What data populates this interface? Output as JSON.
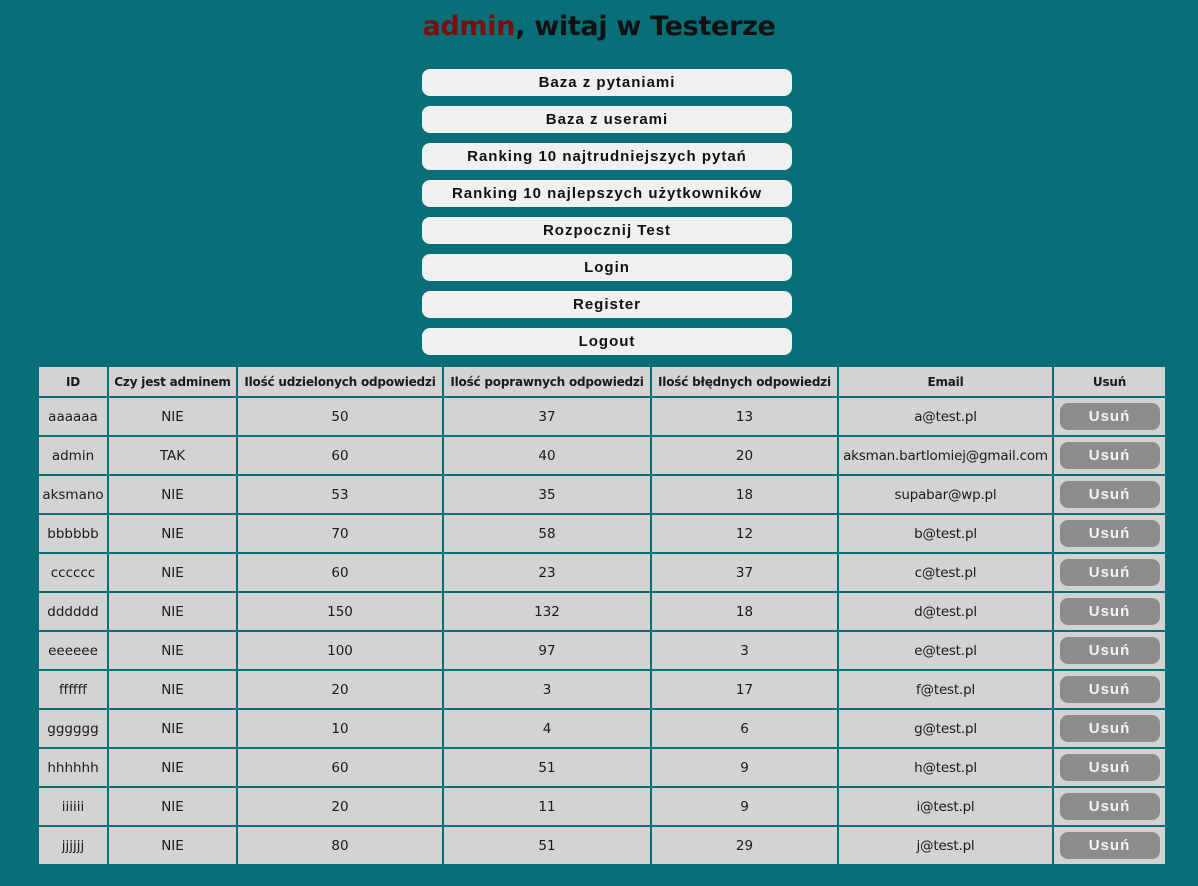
{
  "header": {
    "username": "admin",
    "greeting": ", witaj w Testerze"
  },
  "menu": [
    {
      "label": "Baza z pytaniami",
      "name": "questions-db-button"
    },
    {
      "label": "Baza z userami",
      "name": "users-db-button"
    },
    {
      "label": "Ranking 10 najtrudniejszych pytań",
      "name": "hardest-questions-ranking-button"
    },
    {
      "label": "Ranking 10 najlepszych użytkowników",
      "name": "best-users-ranking-button"
    },
    {
      "label": "Rozpocznij Test",
      "name": "start-test-button"
    },
    {
      "label": "Login",
      "name": "login-button"
    },
    {
      "label": "Register",
      "name": "register-button"
    },
    {
      "label": "Logout",
      "name": "logout-button"
    }
  ],
  "table": {
    "columns": [
      "ID",
      "Czy jest adminem",
      "Ilość udzielonych odpowiedzi",
      "Ilość poprawnych odpowiedzi",
      "Ilość błędnych odpowiedzi",
      "Email",
      "Usuń"
    ],
    "delete_label": "Usuń",
    "rows": [
      [
        "aaaaaa",
        "NIE",
        "50",
        "37",
        "13",
        "a@test.pl"
      ],
      [
        "admin",
        "TAK",
        "60",
        "40",
        "20",
        "aksman.bartlomiej@gmail.com"
      ],
      [
        "aksmano",
        "NIE",
        "53",
        "35",
        "18",
        "supabar@wp.pl"
      ],
      [
        "bbbbbb",
        "NIE",
        "70",
        "58",
        "12",
        "b@test.pl"
      ],
      [
        "cccccc",
        "NIE",
        "60",
        "23",
        "37",
        "c@test.pl"
      ],
      [
        "dddddd",
        "NIE",
        "150",
        "132",
        "18",
        "d@test.pl"
      ],
      [
        "eeeeee",
        "NIE",
        "100",
        "97",
        "3",
        "e@test.pl"
      ],
      [
        "ffffff",
        "NIE",
        "20",
        "3",
        "17",
        "f@test.pl"
      ],
      [
        "gggggg",
        "NIE",
        "10",
        "4",
        "6",
        "g@test.pl"
      ],
      [
        "hhhhhh",
        "NIE",
        "60",
        "51",
        "9",
        "h@test.pl"
      ],
      [
        "iiiiii",
        "NIE",
        "20",
        "11",
        "9",
        "i@test.pl"
      ],
      [
        "jjjjjj",
        "NIE",
        "80",
        "51",
        "29",
        "j@test.pl"
      ]
    ]
  },
  "colors": {
    "background": "#086e78",
    "username": "#7a0f0f",
    "menu_button": "#f0f0f0",
    "cell": "#d3d3d3",
    "delete_button": "#8c8c8c"
  }
}
